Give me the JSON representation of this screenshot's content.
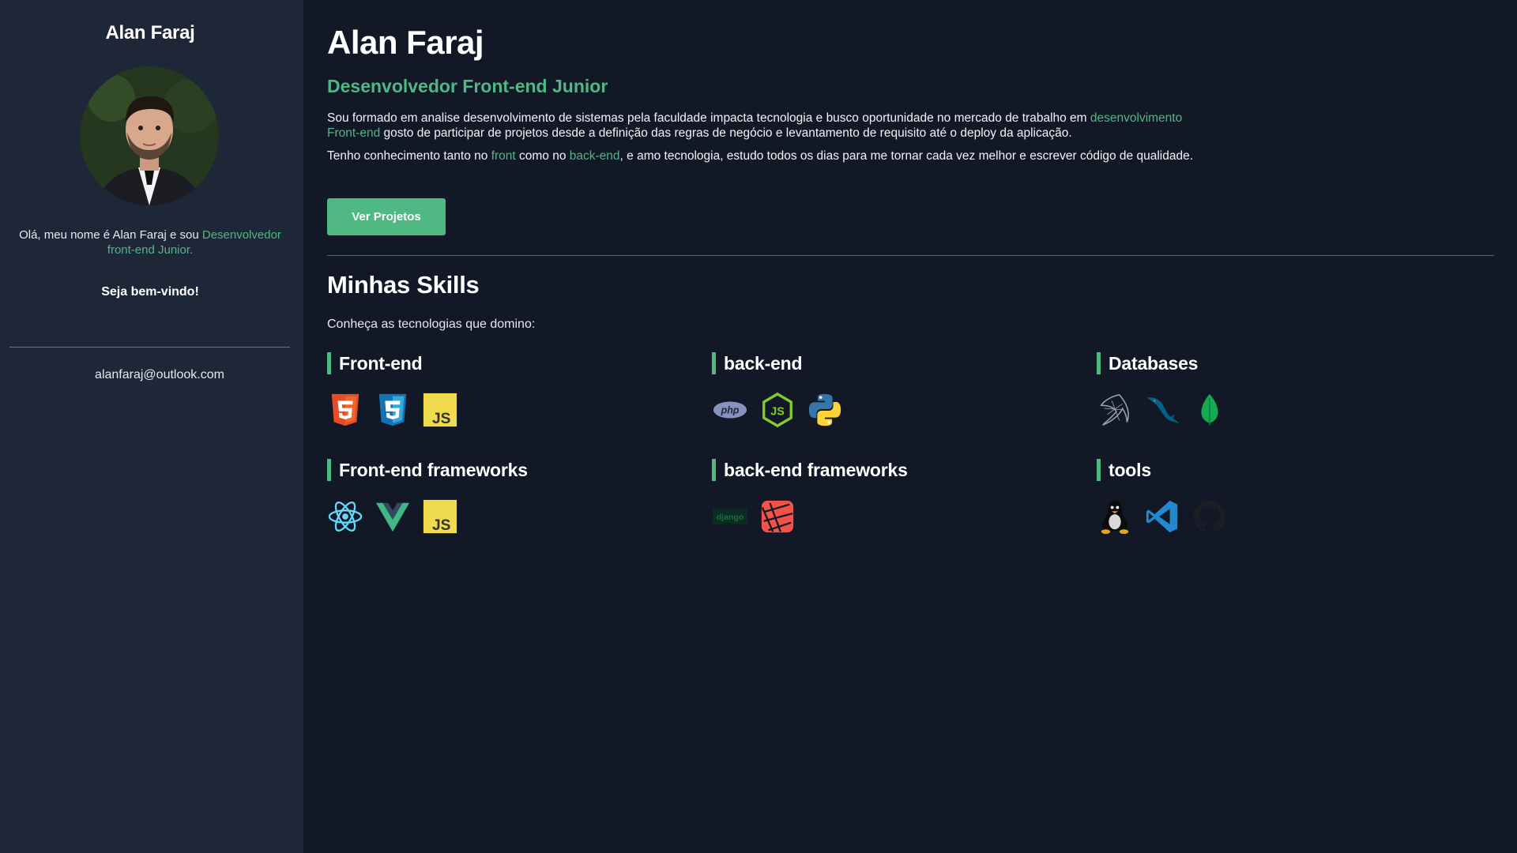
{
  "sidebar": {
    "name": "Alan Faraj",
    "intro_prefix": "Olá, meu nome é Alan Faraj e sou ",
    "intro_role": "Desenvolvedor front-end Junior.",
    "welcome": "Seja bem-vindo!",
    "email": "alanfaraj@outlook.com"
  },
  "main": {
    "title": "Alan Faraj",
    "subtitle": "Desenvolvedor Front-end Junior",
    "para1": {
      "text_a": "Sou formado em analise desenvolvimento de sistemas pela faculdade impacta tecnologia e busco oportunidade no mercado de trabalho em ",
      "highlight": "desenvolvimento Front-end",
      "text_b": " gosto de participar de projetos desde a definição das regras de negócio e levantamento de requisito até o deploy da aplicação."
    },
    "para2": {
      "text_a": "Tenho conhecimento tanto no ",
      "highlight1": "front",
      "text_b": " como no ",
      "highlight2": "back-end",
      "text_c": ", e amo tecnologia, estudo todos os dias para me tornar cada vez melhor e escrever código de qualidade."
    },
    "button_label": "Ver Projetos"
  },
  "skills": {
    "title": "Minhas Skills",
    "description": "Conheça as tecnologias que domino:",
    "groups": [
      {
        "title": "Front-end",
        "icons": [
          "html5-icon",
          "css3-icon",
          "javascript-icon"
        ]
      },
      {
        "title": "back-end",
        "icons": [
          "php-icon",
          "nodejs-icon",
          "python-icon"
        ]
      },
      {
        "title": "Databases",
        "icons": [
          "sql-server-icon",
          "mysql-icon",
          "mongodb-icon"
        ]
      },
      {
        "title": "Front-end frameworks",
        "icons": [
          "react-icon",
          "vue-icon",
          "javascript-icon"
        ]
      },
      {
        "title": "back-end frameworks",
        "icons": [
          "django-icon",
          "laravel-icon"
        ]
      },
      {
        "title": "tools",
        "icons": [
          "linux-icon",
          "vscode-icon",
          "github-icon"
        ]
      }
    ],
    "icon_texts": {
      "php": "php",
      "js": "JS",
      "django": "django"
    }
  },
  "colors": {
    "accent": "#4fb883",
    "background": "#121826",
    "sidebar": "#1e2738"
  }
}
